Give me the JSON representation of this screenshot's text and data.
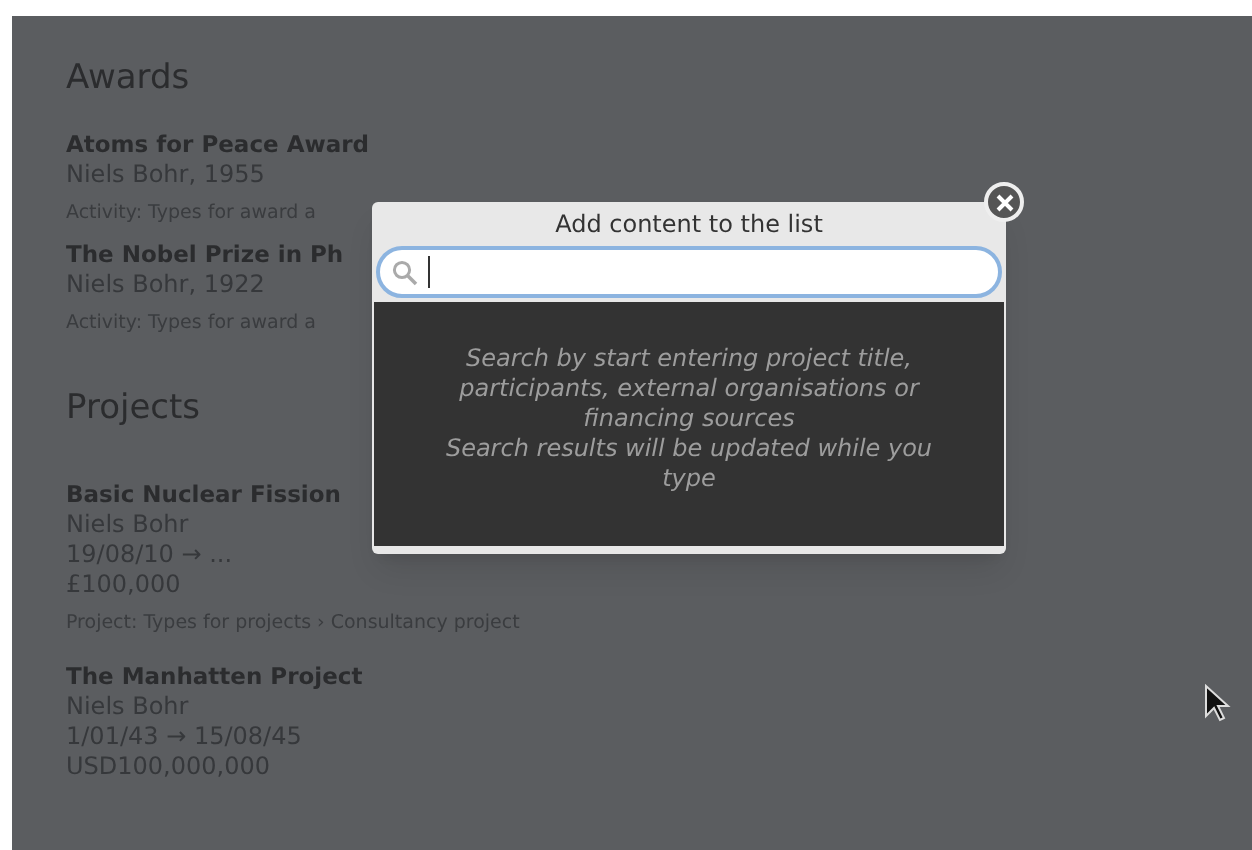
{
  "awards": {
    "heading": "Awards",
    "items": [
      {
        "title": "Atoms for Peace Award",
        "subtitle": "Niels Bohr, 1955",
        "activity": "Activity: Types for award a"
      },
      {
        "title": "The Nobel Prize in Ph",
        "subtitle": "Niels Bohr, 1922",
        "activity": "Activity: Types for award a"
      }
    ]
  },
  "projects": {
    "heading": "Projects",
    "items": [
      {
        "title": "Basic Nuclear Fission",
        "person": "Niels Bohr",
        "dates": "19/08/10 → ...",
        "amount": "£100,000",
        "type": "Project: Types for projects › Consultancy project"
      },
      {
        "title": "The Manhatten Project",
        "person": "Niels Bohr",
        "dates": "1/01/43 → 15/08/45",
        "amount": "USD100,000,000"
      }
    ]
  },
  "dialog": {
    "title": "Add content to the list",
    "hint_lines": [
      "Search by start entering project title, participants, external organisations or financing sources",
      "Search results will be updated while you type"
    ]
  }
}
